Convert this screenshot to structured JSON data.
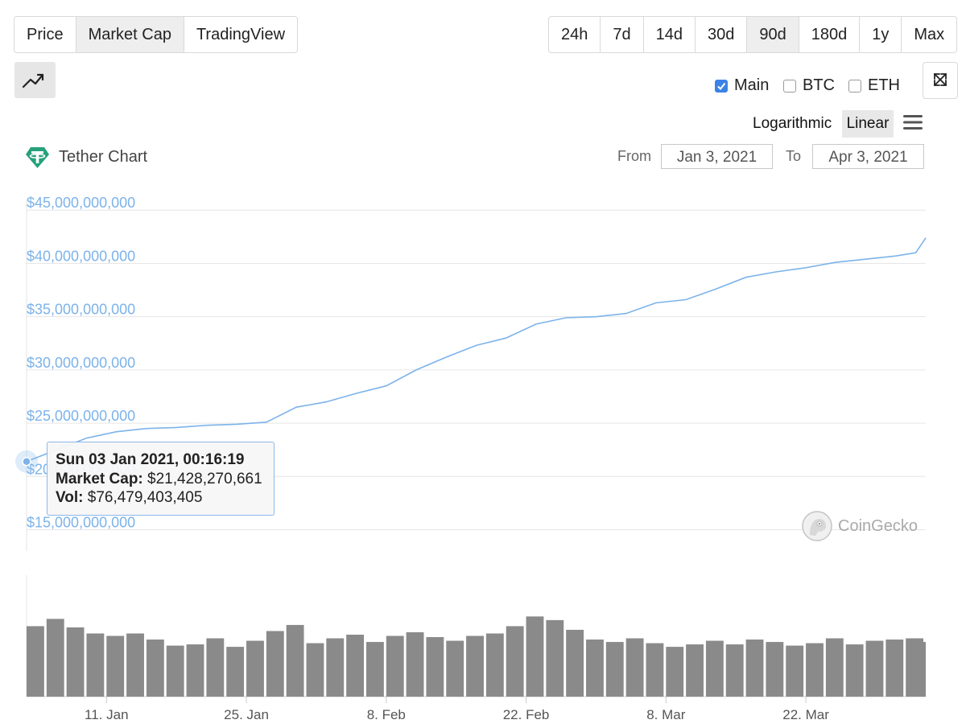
{
  "toolbar": {
    "chart_types": [
      {
        "label": "Price",
        "active": false
      },
      {
        "label": "Market Cap",
        "active": true
      },
      {
        "label": "TradingView",
        "active": false
      }
    ],
    "ranges": [
      {
        "label": "24h",
        "active": false
      },
      {
        "label": "7d",
        "active": false
      },
      {
        "label": "14d",
        "active": false
      },
      {
        "label": "30d",
        "active": false
      },
      {
        "label": "90d",
        "active": true
      },
      {
        "label": "180d",
        "active": false
      },
      {
        "label": "1y",
        "active": false
      },
      {
        "label": "Max",
        "active": false
      }
    ],
    "compare": [
      {
        "label": "Main",
        "checked": true
      },
      {
        "label": "BTC",
        "checked": false
      },
      {
        "label": "ETH",
        "checked": false
      }
    ],
    "scale": {
      "log_label": "Logarithmic",
      "linear_label": "Linear",
      "active": "Linear"
    }
  },
  "header": {
    "title": "Tether Chart",
    "from_label": "From",
    "from_value": "Jan 3, 2021",
    "to_label": "To",
    "to_value": "Apr 3, 2021"
  },
  "tooltip": {
    "timestamp": "Sun 03 Jan 2021, 00:16:19",
    "market_cap_label": "Market Cap:",
    "market_cap_value": "$21,428,270,661",
    "vol_label": "Vol:",
    "vol_value": "$76,479,403,405"
  },
  "watermark": "CoinGecko",
  "colors": {
    "line": "#7cb3ea",
    "axis_text": "#7cb3ea",
    "volume": "#8a8a8a",
    "grid": "#e6e6e6",
    "accent": "#3b82e6"
  },
  "chart_data": {
    "type": "line",
    "series": [
      {
        "x": [
          "2021-01-03",
          "2021-01-06",
          "2021-01-09",
          "2021-01-12",
          "2021-01-15",
          "2021-01-18",
          "2021-01-21",
          "2021-01-24",
          "2021-01-27",
          "2021-01-30",
          "2021-02-02",
          "2021-02-05",
          "2021-02-08",
          "2021-02-11",
          "2021-02-14",
          "2021-02-17",
          "2021-02-20",
          "2021-02-23",
          "2021-02-26",
          "2021-03-01",
          "2021-03-04",
          "2021-03-07",
          "2021-03-10",
          "2021-03-13",
          "2021-03-16",
          "2021-03-19",
          "2021-03-22",
          "2021-03-25",
          "2021-03-28",
          "2021-03-31",
          "2021-04-02",
          "2021-04-03"
        ],
        "values": [
          21.4,
          22.5,
          23.6,
          24.2,
          24.5,
          24.6,
          24.8,
          24.9,
          25.1,
          26.5,
          27.0,
          27.8,
          28.5,
          30.0,
          31.2,
          32.3,
          33.0,
          34.3,
          34.9,
          35.0,
          35.3,
          36.3,
          36.6,
          37.6,
          38.7,
          39.2,
          39.6,
          40.1,
          40.4,
          40.7,
          41.0,
          42.4
        ]
      }
    ],
    "volume": [
      {
        "x": "2021-01-03",
        "v": 58
      },
      {
        "x": "2021-01-05",
        "v": 64
      },
      {
        "x": "2021-01-07",
        "v": 57
      },
      {
        "x": "2021-01-09",
        "v": 52
      },
      {
        "x": "2021-01-11",
        "v": 50
      },
      {
        "x": "2021-01-13",
        "v": 52
      },
      {
        "x": "2021-01-15",
        "v": 47
      },
      {
        "x": "2021-01-17",
        "v": 42
      },
      {
        "x": "2021-01-19",
        "v": 43
      },
      {
        "x": "2021-01-21",
        "v": 48
      },
      {
        "x": "2021-01-23",
        "v": 41
      },
      {
        "x": "2021-01-25",
        "v": 46
      },
      {
        "x": "2021-01-27",
        "v": 54
      },
      {
        "x": "2021-01-29",
        "v": 59
      },
      {
        "x": "2021-01-31",
        "v": 44
      },
      {
        "x": "2021-02-02",
        "v": 48
      },
      {
        "x": "2021-02-04",
        "v": 51
      },
      {
        "x": "2021-02-06",
        "v": 45
      },
      {
        "x": "2021-02-08",
        "v": 50
      },
      {
        "x": "2021-02-10",
        "v": 53
      },
      {
        "x": "2021-02-12",
        "v": 49
      },
      {
        "x": "2021-02-14",
        "v": 46
      },
      {
        "x": "2021-02-16",
        "v": 50
      },
      {
        "x": "2021-02-18",
        "v": 52
      },
      {
        "x": "2021-02-20",
        "v": 58
      },
      {
        "x": "2021-02-22",
        "v": 66
      },
      {
        "x": "2021-02-24",
        "v": 63
      },
      {
        "x": "2021-02-26",
        "v": 55
      },
      {
        "x": "2021-02-28",
        "v": 47
      },
      {
        "x": "2021-03-02",
        "v": 45
      },
      {
        "x": "2021-03-04",
        "v": 48
      },
      {
        "x": "2021-03-06",
        "v": 44
      },
      {
        "x": "2021-03-08",
        "v": 41
      },
      {
        "x": "2021-03-10",
        "v": 43
      },
      {
        "x": "2021-03-12",
        "v": 46
      },
      {
        "x": "2021-03-14",
        "v": 43
      },
      {
        "x": "2021-03-16",
        "v": 47
      },
      {
        "x": "2021-03-18",
        "v": 45
      },
      {
        "x": "2021-03-20",
        "v": 42
      },
      {
        "x": "2021-03-22",
        "v": 44
      },
      {
        "x": "2021-03-24",
        "v": 48
      },
      {
        "x": "2021-03-26",
        "v": 43
      },
      {
        "x": "2021-03-28",
        "v": 46
      },
      {
        "x": "2021-03-30",
        "v": 47
      },
      {
        "x": "2021-04-01",
        "v": 48
      },
      {
        "x": "2021-04-03",
        "v": 45
      }
    ],
    "x_range": [
      "2021-01-03",
      "2021-04-03"
    ],
    "ylim": [
      13,
      46
    ],
    "y_ticks": [
      {
        "value": 45,
        "label": "$45,000,000,000"
      },
      {
        "value": 40,
        "label": "$40,000,000,000"
      },
      {
        "value": 35,
        "label": "$35,000,000,000"
      },
      {
        "value": 30,
        "label": "$30,000,000,000"
      },
      {
        "value": 25,
        "label": "$25,000,000,000"
      },
      {
        "value": 20,
        "label": "$20,000,000,000"
      },
      {
        "value": 15,
        "label": "$15,000,000,000"
      }
    ],
    "x_ticks": [
      {
        "date": "2021-01-11",
        "label": "11. Jan"
      },
      {
        "date": "2021-01-25",
        "label": "25. Jan"
      },
      {
        "date": "2021-02-08",
        "label": "8. Feb"
      },
      {
        "date": "2021-02-22",
        "label": "22. Feb"
      },
      {
        "date": "2021-03-08",
        "label": "8. Mar"
      },
      {
        "date": "2021-03-22",
        "label": "22. Mar"
      }
    ],
    "grid": true,
    "legend": "none"
  }
}
